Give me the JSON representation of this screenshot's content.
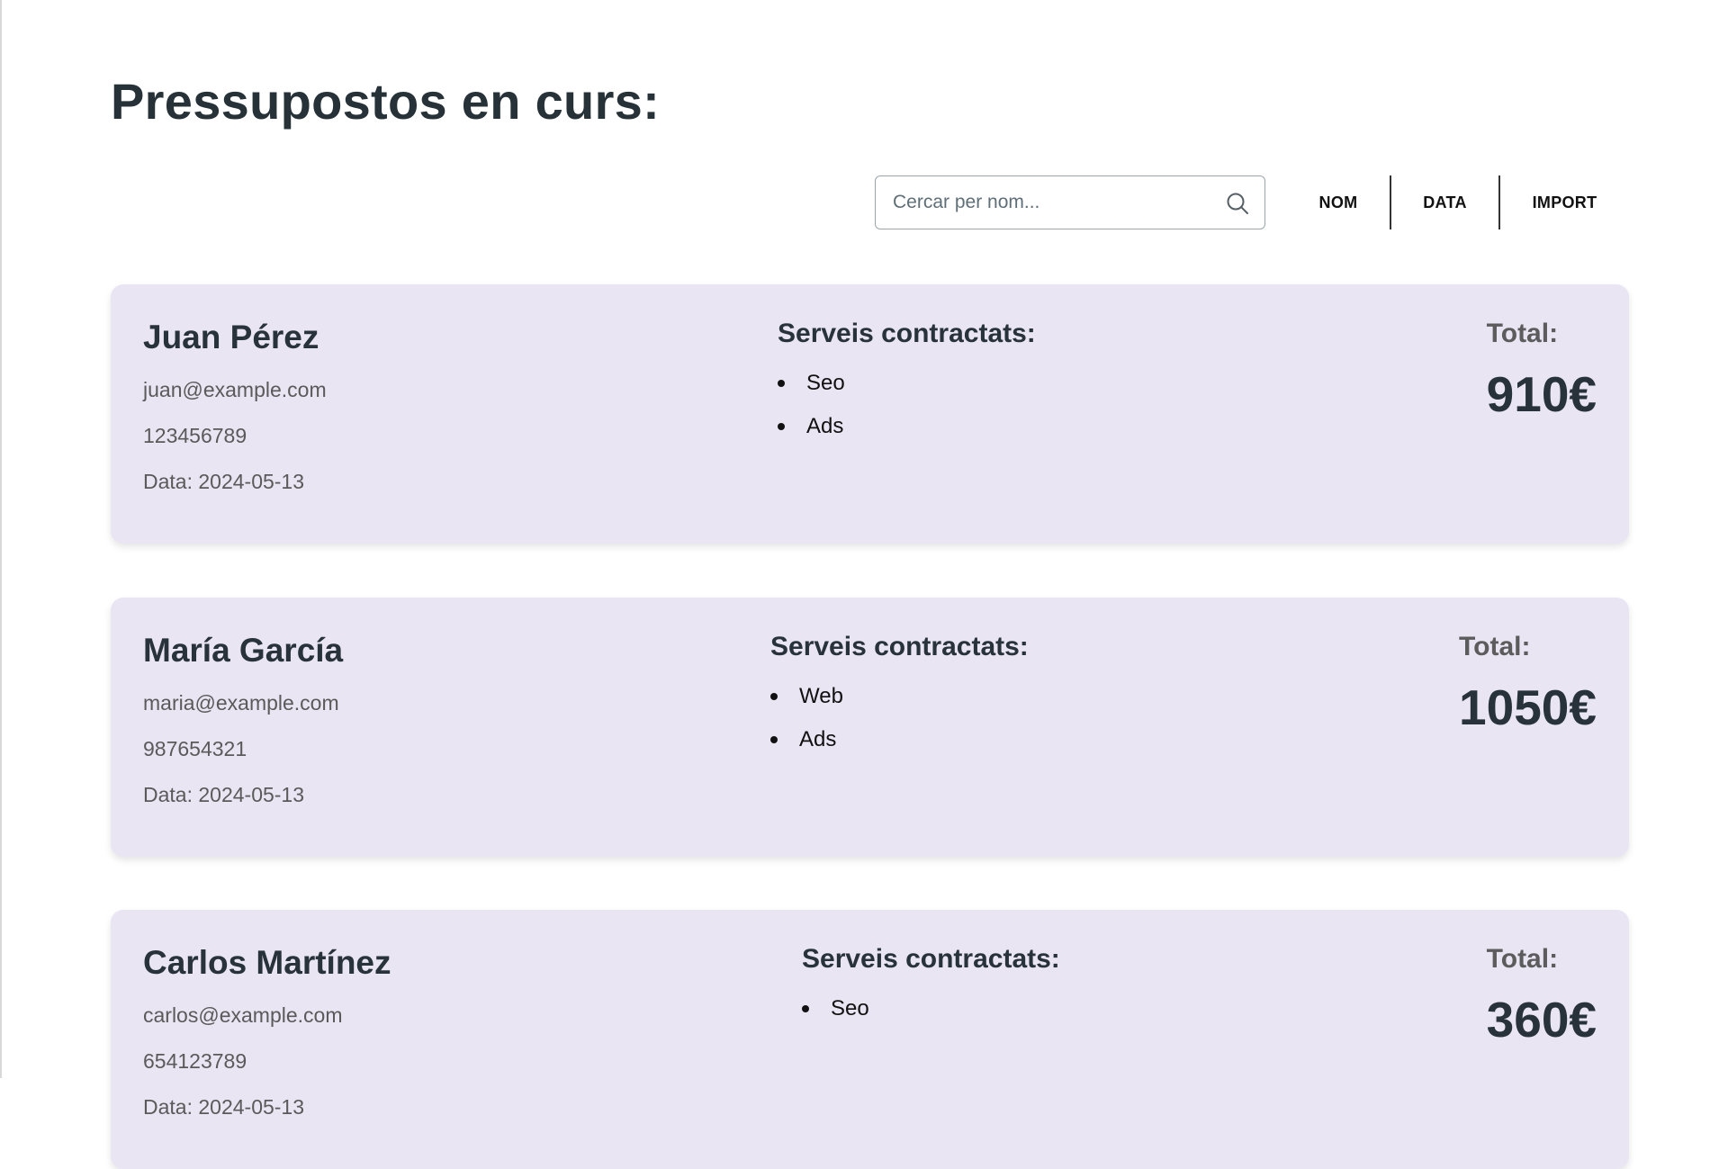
{
  "page": {
    "title": "Pressupostos en curs:"
  },
  "search": {
    "placeholder": "Cercar per nom...",
    "value": "",
    "icon": "search-icon"
  },
  "sort": {
    "name_label": "NOM",
    "date_label": "DATA",
    "amount_label": "IMPORT"
  },
  "labels": {
    "services_title": "Serveis contractats:",
    "total_label": "Total:"
  },
  "budgets": [
    {
      "name": "Juan Pérez",
      "email": "juan@example.com",
      "phone": "123456789",
      "date": "Data: 2024-05-13",
      "services": [
        "Seo",
        "Ads"
      ],
      "total": "910€"
    },
    {
      "name": "María García",
      "email": "maria@example.com",
      "phone": "987654321",
      "date": "Data: 2024-05-13",
      "services": [
        "Web",
        "Ads"
      ],
      "total": "1050€"
    },
    {
      "name": "Carlos Martínez",
      "email": "carlos@example.com",
      "phone": "654123789",
      "date": "Data: 2024-05-13",
      "services": [
        "Seo"
      ],
      "total": "360€"
    }
  ],
  "colors": {
    "card_background": "#e9e5f3",
    "title_text": "#263238"
  }
}
